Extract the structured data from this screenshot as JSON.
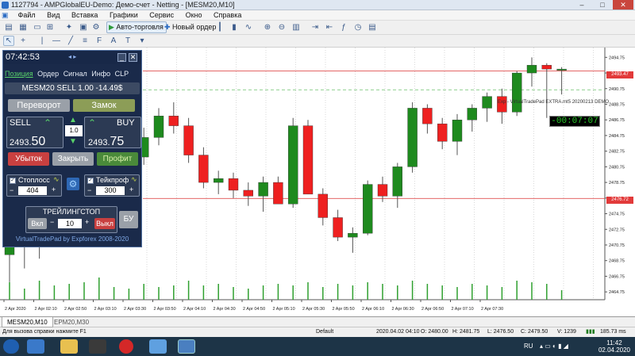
{
  "window": {
    "title": "1127794 - AMPGlobalEU-Demo: Демо-счет - Netting - [MESM20,M10]",
    "controls": [
      "–",
      "□",
      "✕"
    ]
  },
  "menu": [
    "Файл",
    "Вид",
    "Вставка",
    "Графики",
    "Сервис",
    "Окно",
    "Справка"
  ],
  "toolbar": {
    "autotrade_label": "Авто-торговля",
    "neworder_label": "Новый ордер"
  },
  "panel": {
    "time": "07:42:53",
    "tabs": [
      "Позиция",
      "Ордер",
      "Сигнал",
      "Инфо",
      "CLP"
    ],
    "position_info": "MESM20 SELL 1.00 -14.49$",
    "reverse_label": "Переворот",
    "lock_label": "Замок",
    "sell_label": "SELL",
    "buy_label": "BUY",
    "sell_price_small": "2493.",
    "sell_price_big": "50",
    "buy_price_small": "2493.",
    "buy_price_big": "75",
    "lot": "1.0",
    "loss_label": "Убыток",
    "close_label": "Закрыть",
    "profit_label": "Профит",
    "stoploss_label": "Стоплосс",
    "stoploss_value": "404",
    "takeprofit_label": "Тейкпроф",
    "takeprofit_value": "300",
    "trailing_label": "ТРЕЙЛИНГСТОП",
    "trail_on_label": "Вкл",
    "trail_value": "10",
    "trail_off_label": "Выкл",
    "bu_label": "БУ",
    "footer": "VirtualTradePad by Expforex 2008-2020"
  },
  "chart": {
    "ea_label": "Exp - VirtualTradePad EXTRA.mt5 20200213 DEMO",
    "timer": "-00:07:07",
    "price_tag_bid": "2493.47",
    "price_tag_red": "2476.72"
  },
  "chart_data": {
    "type": "candlestick",
    "y_ticks": [
      "2494.75",
      "2492.75",
      "2490.75",
      "2488.75",
      "2486.75",
      "2484.75",
      "2482.75",
      "2480.75",
      "2478.75",
      "2476.75",
      "2474.75",
      "2472.75",
      "2470.75",
      "2468.75",
      "2466.75",
      "2464.75"
    ],
    "x_ticks": [
      "2 Apr 2020",
      "2 Apr 02:10",
      "2 Apr 02:50",
      "2 Apr 03:10",
      "2 Apr 03:30",
      "2 Apr 03:50",
      "2 Apr 04:10",
      "2 Apr 04:30",
      "2 Apr 04:50",
      "2 Apr 05:10",
      "2 Apr 05:30",
      "2 Apr 05:50",
      "2 Apr 06:10",
      "2 Apr 06:30",
      "2 Apr 06:50",
      "2 Apr 07:10",
      "2 Apr 07:30"
    ],
    "ylim": [
      2463.75,
      2496.0
    ],
    "candles": [
      {
        "o": 2469.5,
        "h": 2472.5,
        "l": 2466.0,
        "c": 2471.0
      },
      {
        "o": 2471.0,
        "h": 2475.0,
        "l": 2467.75,
        "c": 2472.25
      },
      {
        "o": 2472.25,
        "h": 2475.5,
        "l": 2469.0,
        "c": 2474.5
      },
      {
        "o": 2474.5,
        "h": 2477.0,
        "l": 2472.0,
        "c": 2476.0
      },
      {
        "o": 2476.0,
        "h": 2477.5,
        "l": 2473.5,
        "c": 2474.75
      },
      {
        "o": 2474.75,
        "h": 2477.0,
        "l": 2471.5,
        "c": 2475.75
      },
      {
        "o": 2475.75,
        "h": 2479.0,
        "l": 2474.0,
        "c": 2478.25
      },
      {
        "o": 2478.25,
        "h": 2481.5,
        "l": 2476.75,
        "c": 2480.5
      },
      {
        "o": 2480.5,
        "h": 2483.0,
        "l": 2478.75,
        "c": 2482.0
      },
      {
        "o": 2482.0,
        "h": 2485.75,
        "l": 2481.0,
        "c": 2484.5
      },
      {
        "o": 2484.5,
        "h": 2488.25,
        "l": 2483.5,
        "c": 2487.25
      },
      {
        "o": 2487.25,
        "h": 2489.0,
        "l": 2485.0,
        "c": 2486.0
      },
      {
        "o": 2486.0,
        "h": 2487.0,
        "l": 2481.25,
        "c": 2482.25
      },
      {
        "o": 2482.25,
        "h": 2483.25,
        "l": 2478.0,
        "c": 2478.75
      },
      {
        "o": 2478.75,
        "h": 2480.25,
        "l": 2477.25,
        "c": 2479.25
      },
      {
        "o": 2479.25,
        "h": 2480.0,
        "l": 2476.75,
        "c": 2477.75
      },
      {
        "o": 2477.75,
        "h": 2478.75,
        "l": 2475.75,
        "c": 2477.0
      },
      {
        "o": 2477.0,
        "h": 2479.5,
        "l": 2475.0,
        "c": 2478.75
      },
      {
        "o": 2478.75,
        "h": 2479.5,
        "l": 2476.25,
        "c": 2476.0
      },
      {
        "o": 2476.0,
        "h": 2487.0,
        "l": 2475.5,
        "c": 2486.0
      },
      {
        "o": 2486.0,
        "h": 2486.75,
        "l": 2477.25,
        "c": 2477.25
      },
      {
        "o": 2477.25,
        "h": 2478.0,
        "l": 2473.25,
        "c": 2474.25
      },
      {
        "o": 2474.25,
        "h": 2475.25,
        "l": 2471.25,
        "c": 2471.75
      },
      {
        "o": 2471.75,
        "h": 2473.0,
        "l": 2469.75,
        "c": 2472.25
      },
      {
        "o": 2472.25,
        "h": 2479.0,
        "l": 2472.0,
        "c": 2478.5
      },
      {
        "o": 2478.5,
        "h": 2479.5,
        "l": 2476.25,
        "c": 2477.0
      },
      {
        "o": 2477.0,
        "h": 2481.25,
        "l": 2475.5,
        "c": 2480.75
      },
      {
        "o": 2480.75,
        "h": 2489.0,
        "l": 2480.0,
        "c": 2488.25
      },
      {
        "o": 2488.25,
        "h": 2488.75,
        "l": 2485.0,
        "c": 2486.25
      },
      {
        "o": 2486.25,
        "h": 2487.0,
        "l": 2483.0,
        "c": 2484.0
      },
      {
        "o": 2484.0,
        "h": 2487.5,
        "l": 2482.25,
        "c": 2486.75
      },
      {
        "o": 2486.75,
        "h": 2488.75,
        "l": 2485.25,
        "c": 2488.25
      },
      {
        "o": 2488.25,
        "h": 2490.25,
        "l": 2486.5,
        "c": 2489.75
      },
      {
        "o": 2489.75,
        "h": 2490.75,
        "l": 2486.25,
        "c": 2487.75
      },
      {
        "o": 2487.75,
        "h": 2493.0,
        "l": 2487.25,
        "c": 2492.75
      },
      {
        "o": 2492.75,
        "h": 2494.75,
        "l": 2491.0,
        "c": 2493.75
      },
      {
        "o": 2493.75,
        "h": 2494.0,
        "l": 2487.0,
        "c": 2493.25
      },
      {
        "o": 2493.25,
        "h": 2493.5,
        "l": 2490.0,
        "c": 2493.25
      }
    ],
    "volume": [
      0.55,
      0.35,
      0.6,
      0.45,
      0.5,
      0.55,
      0.7,
      0.4,
      0.35,
      0.5,
      0.4,
      0.45,
      0.6,
      0.45,
      0.5,
      0.4,
      0.35,
      0.45,
      0.5,
      0.45,
      0.55,
      0.4,
      0.5,
      0.45,
      0.55,
      0.5,
      0.45,
      0.6,
      0.5,
      0.45,
      0.4,
      0.5,
      0.45,
      0.4,
      0.6,
      0.55,
      0.5,
      0.3
    ]
  },
  "chart_tabs": [
    "MESM20,M10",
    "EPM20,M30"
  ],
  "status": {
    "help": "Для вызова справки нажмите F1",
    "profile": "Default",
    "datetime": "2020.04.02 04:10",
    "open": "O: 2480.00",
    "high": "H: 2481.75",
    "low": "L: 2476.50",
    "close": "C: 2479.50",
    "volume": "V: 1239",
    "traffic": "185.73 ms"
  },
  "taskbar": {
    "lang": "RU",
    "time": "11:42",
    "date": "02.04.2020"
  }
}
